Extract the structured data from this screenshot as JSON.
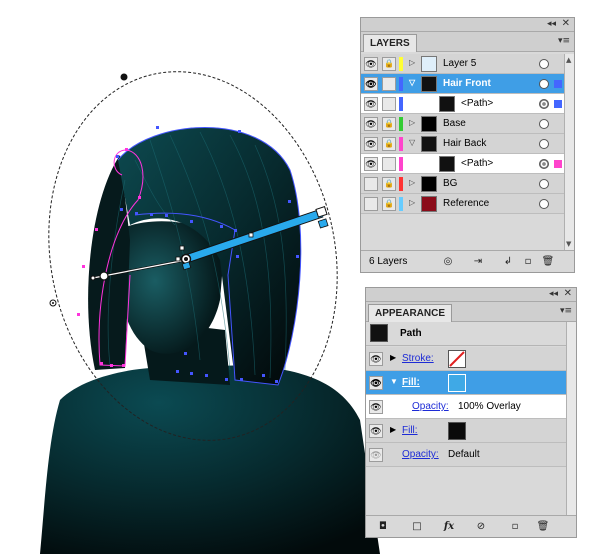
{
  "layers_panel": {
    "tab_label": "LAYERS",
    "collapse_glyph": "◂◂",
    "close_glyph": "✕",
    "menu_glyph": "▾≡",
    "layers": [
      {
        "name": "Layer 5",
        "color": "#ffff33",
        "type": "layer",
        "expanded": false,
        "selected": false
      },
      {
        "name": "Hair Front",
        "color": "#4466ff",
        "type": "layer",
        "expanded": true,
        "selected": true
      },
      {
        "name": "<Path>",
        "color": "#4466ff",
        "type": "sublayer",
        "selected": false
      },
      {
        "name": "Base",
        "color": "#33cc33",
        "type": "layer",
        "expanded": false,
        "selected": false
      },
      {
        "name": "Hair Back",
        "color": "#ff44cc",
        "type": "layer",
        "expanded": true,
        "selected": false
      },
      {
        "name": "<Path>",
        "color": "#ff44cc",
        "type": "sublayer",
        "selected": false
      },
      {
        "name": "BG",
        "color": "#ff3333",
        "type": "layer",
        "expanded": false,
        "selected": false
      },
      {
        "name": "Reference",
        "color": "#66ccff",
        "type": "layer",
        "expanded": false,
        "selected": false
      }
    ],
    "footer": {
      "count_label": "6 Layers",
      "icons": [
        "locate-object-icon",
        "make-clipping-mask-icon",
        "new-sublayer-icon",
        "new-layer-icon",
        "delete-icon"
      ]
    }
  },
  "appearance_panel": {
    "tab_label": "APPEARANCE",
    "collapse_glyph": "◂◂",
    "close_glyph": "✕",
    "menu_glyph": "▾≡",
    "object_label": "Path",
    "rows": {
      "stroke_label": "Stroke:",
      "fill1_label": "Fill:",
      "opacity1_label": "Opacity:",
      "opacity1_value": "100% Overlay",
      "fill2_label": "Fill:",
      "opacity2_label": "Opacity:",
      "opacity2_value": "Default"
    },
    "colors": {
      "fill1_swatch": "#3fa9e6",
      "fill2_swatch": "#0a0a0a",
      "accent_selected": "#3f9ee6"
    },
    "footer": {
      "icons": [
        "add-new-stroke-icon",
        "add-new-fill-icon",
        "fx-icon",
        "clear-appearance-icon",
        "duplicate-item-icon",
        "delete-item-icon"
      ],
      "fx_label": "fx"
    }
  },
  "artwork": {
    "gradient_colors": {
      "light": "#00c8ff",
      "dark": "#000000"
    },
    "path_colors": {
      "front": "#4455ff",
      "back": "#ff33dd"
    }
  }
}
